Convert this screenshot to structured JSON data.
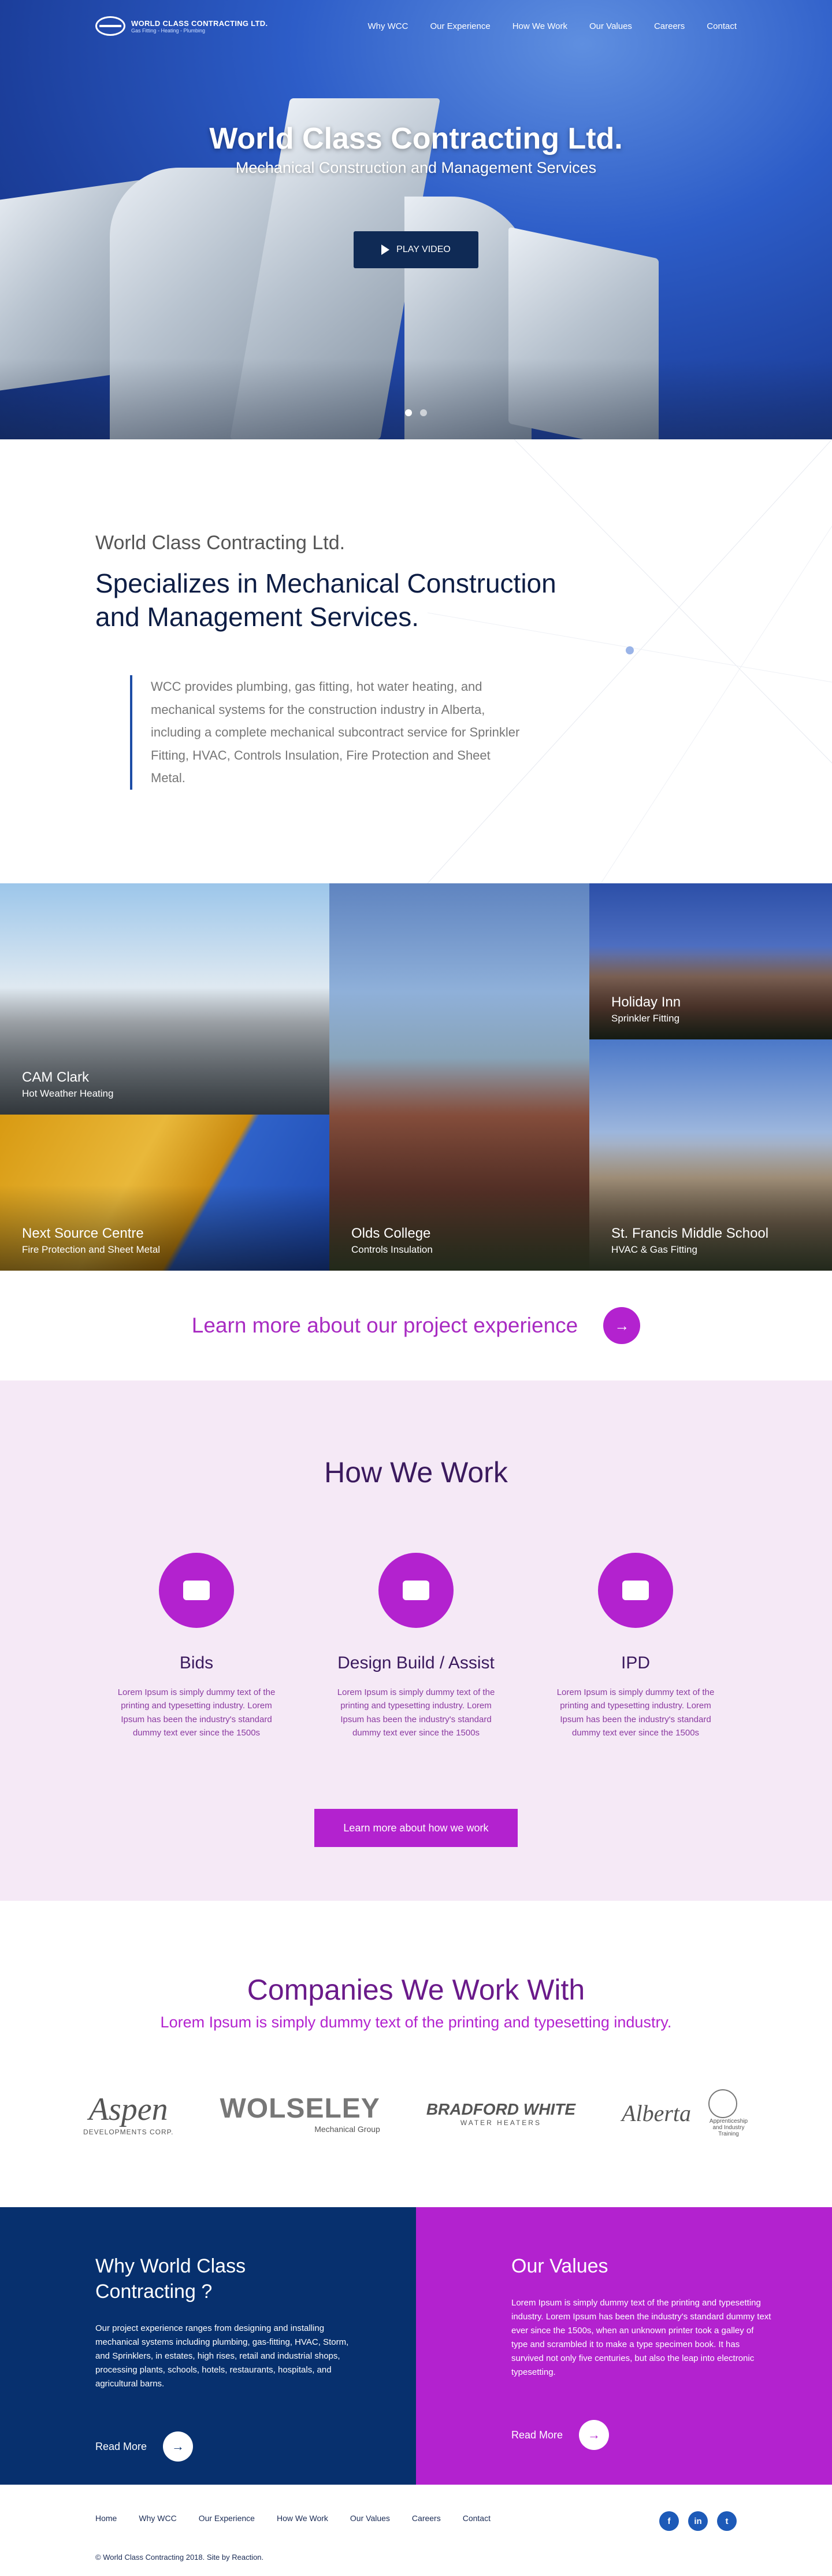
{
  "brand": {
    "name": "WORLD CLASS CONTRACTING LTD.",
    "tagline": "Gas Fitting - Heating - Plumbing"
  },
  "nav": [
    "Why WCC",
    "Our Experience",
    "How We Work",
    "Our Values",
    "Careers",
    "Contact"
  ],
  "hero": {
    "title": "World Class Contracting Ltd.",
    "subtitle": "Mechanical Construction and Management Services",
    "play_label": "PLAY VIDEO"
  },
  "intro": {
    "kicker": "World Class Contracting Ltd.",
    "heading": "Specializes in Mechanical Construction and Management Services.",
    "quote": "WCC provides plumbing, gas fitting, hot water heating, and mechanical systems for the construction industry in Alberta, including a complete mechanical subcontract service for Sprinkler Fitting, HVAC, Controls Insulation, Fire Protection and Sheet Metal."
  },
  "projects": [
    {
      "title": "CAM Clark",
      "service": "Hot Weather Heating"
    },
    {
      "title": "Next Source Centre",
      "service": "Fire Protection and Sheet Metal"
    },
    {
      "title": "Olds College",
      "service": "Controls Insulation"
    },
    {
      "title": "Holiday Inn",
      "service": "Sprinkler Fitting"
    },
    {
      "title": "St. Francis Middle School",
      "service": "HVAC & Gas Fitting"
    }
  ],
  "cta": {
    "text": "Learn more about our project experience",
    "icon": "arrow-right-icon"
  },
  "how": {
    "title": "How We Work",
    "items": [
      {
        "title": "Bids",
        "text": "Lorem Ipsum is simply dummy text of the printing and typesetting industry. Lorem Ipsum has been the industry's standard dummy text ever since the 1500s"
      },
      {
        "title": "Design Build / Assist",
        "text": "Lorem Ipsum is simply dummy text of the printing and typesetting industry. Lorem Ipsum has been the industry's standard dummy text ever since the 1500s"
      },
      {
        "title": "IPD",
        "text": "Lorem Ipsum is simply dummy text of the printing and typesetting industry. Lorem Ipsum has been the industry's standard dummy text ever since the 1500s"
      }
    ],
    "button": "Learn more about how we work"
  },
  "companies": {
    "title": "Companies We Work With",
    "subtitle": "Lorem Ipsum is simply dummy text of the printing and typesetting industry.",
    "logos": {
      "aspen": {
        "name": "Aspen",
        "sub": "DEVELOPMENTS CORP."
      },
      "wolseley": {
        "name": "WOLSELEY",
        "sub": "Mechanical Group"
      },
      "bradford": {
        "name": "BRADFORD WHITE",
        "sub": "WATER HEATERS"
      },
      "alberta": {
        "name": "Alberta",
        "sub": "Apprenticeship and Industry Training"
      }
    }
  },
  "why": {
    "title": "Why World Class Contracting ?",
    "text": "Our project experience ranges from designing and installing mechanical systems including plumbing, gas-fitting, HVAC, Storm, and Sprinklers, in estates, high rises, retail and industrial shops, processing plants, schools, hotels, restaurants, hospitals, and agricultural barns.",
    "link": "Read More"
  },
  "values": {
    "title": "Our Values",
    "text": "Lorem Ipsum is simply dummy text of the printing and typesetting industry. Lorem Ipsum has been the industry's standard dummy text ever since the 1500s, when an unknown printer took a galley of type and scrambled it to make a type specimen book. It has survived not only five centuries, but also the leap into electronic typesetting.",
    "link": "Read More"
  },
  "footer": {
    "nav": [
      "Home",
      "Why WCC",
      "Our Experience",
      "How We Work",
      "Our Values",
      "Careers",
      "Contact"
    ],
    "copyright": "© World Class Contracting 2018. Site by Reaction.",
    "social": [
      "f",
      "in",
      "t"
    ]
  },
  "colors": {
    "navy": "#07306e",
    "purple": "#b322cf",
    "lavender": "#f5e9f6"
  }
}
